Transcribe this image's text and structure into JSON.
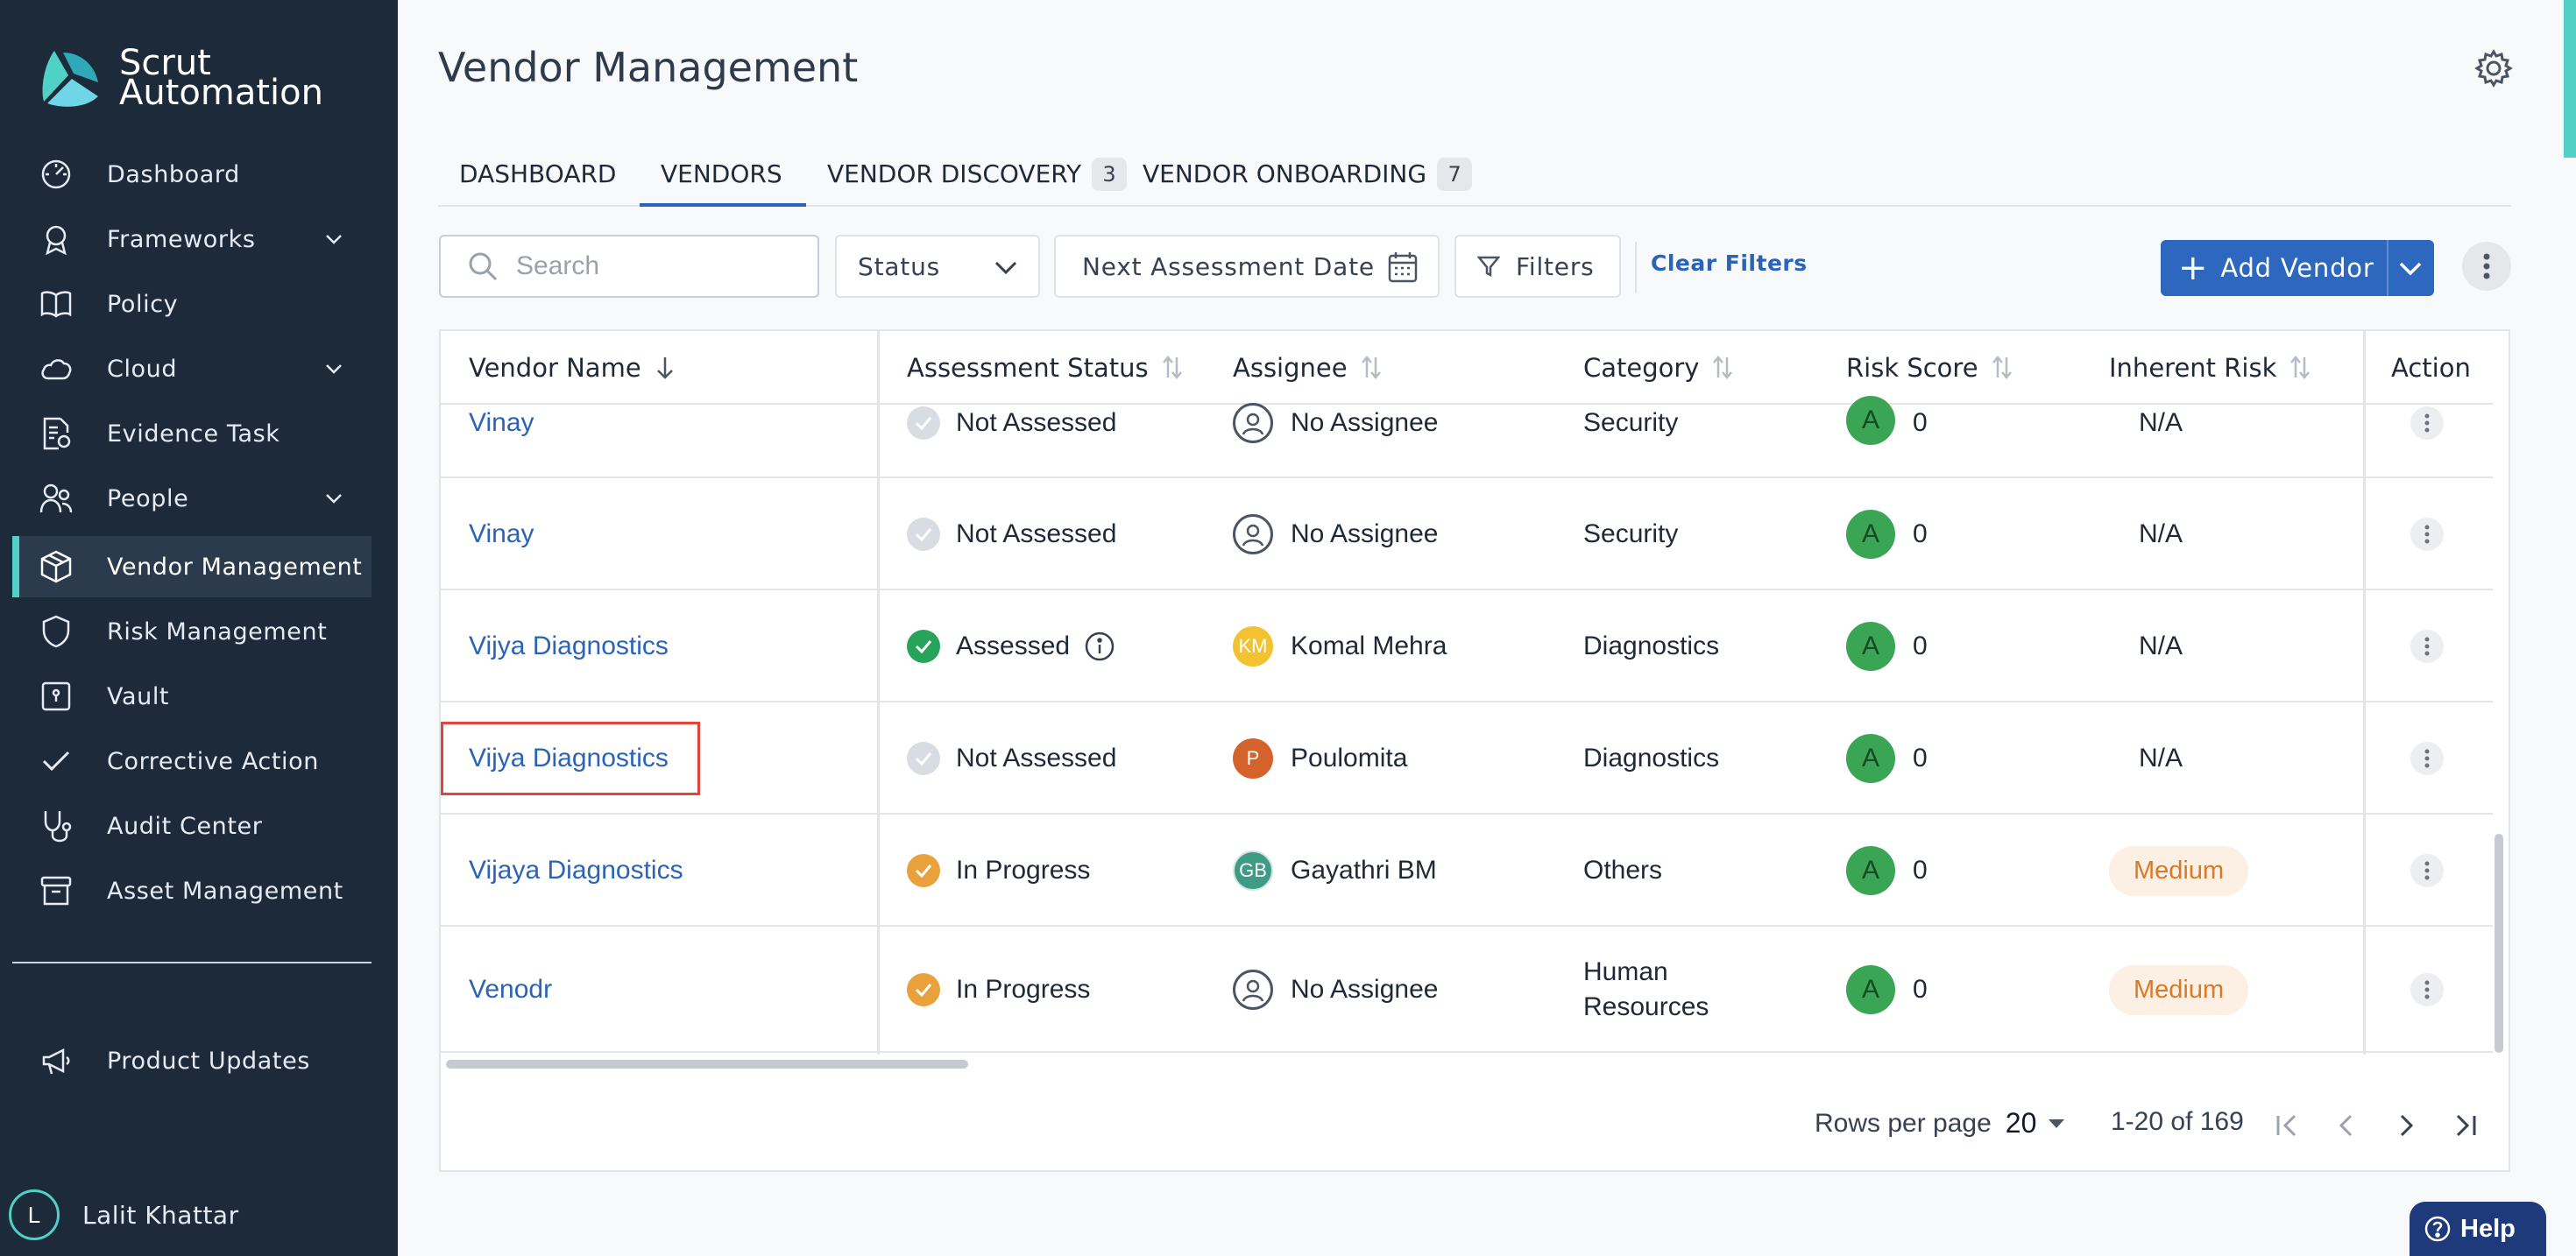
{
  "brand": {
    "line1": "Scrut",
    "line2": "Automation"
  },
  "sidebar": {
    "items": [
      {
        "label": "Dashboard",
        "icon": "dashboard-icon"
      },
      {
        "label": "Frameworks",
        "icon": "frameworks-icon",
        "expandable": true
      },
      {
        "label": "Policy",
        "icon": "policy-icon"
      },
      {
        "label": "Cloud",
        "icon": "cloud-icon",
        "expandable": true
      },
      {
        "label": "Evidence Task",
        "icon": "evidence-icon"
      },
      {
        "label": "People",
        "icon": "people-icon",
        "expandable": true
      },
      {
        "label": "Vendor Management",
        "icon": "vendor-icon",
        "active": true
      },
      {
        "label": "Risk Management",
        "icon": "shield-icon"
      },
      {
        "label": "Vault",
        "icon": "vault-icon"
      },
      {
        "label": "Corrective Action",
        "icon": "check-icon"
      },
      {
        "label": "Audit Center",
        "icon": "stethoscope-icon"
      },
      {
        "label": "Asset Management",
        "icon": "archive-icon"
      }
    ],
    "bottom_items": [
      {
        "label": "Product Updates",
        "icon": "megaphone-icon"
      }
    ],
    "user": {
      "initial": "L",
      "name": "Lalit Khattar"
    }
  },
  "page": {
    "title": "Vendor Management"
  },
  "tabs": [
    {
      "label": "DASHBOARD"
    },
    {
      "label": "VENDORS",
      "active": true
    },
    {
      "label": "VENDOR DISCOVERY",
      "badge": "3"
    },
    {
      "label": "VENDOR ONBOARDING",
      "badge": "7"
    }
  ],
  "toolbar": {
    "search_placeholder": "Search",
    "status_label": "Status",
    "date_label": "Next Assessment Date",
    "filters_label": "Filters",
    "clear_label": "Clear Filters",
    "add_label": "Add Vendor"
  },
  "table": {
    "columns": [
      "Vendor Name",
      "Assessment Status",
      "Assignee",
      "Category",
      "Risk Score",
      "Inherent Risk",
      "Action"
    ],
    "rows": [
      {
        "name": "Vinay",
        "status": "Not Assessed",
        "status_kind": "not",
        "assignee": "No Assignee",
        "assignee_kind": "none",
        "category": "Security",
        "risk_grade": "A",
        "risk_score": "0",
        "inherent": "N/A"
      },
      {
        "name": "Vinay",
        "status": "Not Assessed",
        "status_kind": "not",
        "assignee": "No Assignee",
        "assignee_kind": "none",
        "category": "Security",
        "risk_grade": "A",
        "risk_score": "0",
        "inherent": "N/A"
      },
      {
        "name": "Vijya Diagnostics",
        "status": "Assessed",
        "status_kind": "ok",
        "assignee": "Komal Mehra",
        "assignee_initials": "KM",
        "assignee_color": "#f2c230",
        "category": "Diagnostics",
        "risk_grade": "A",
        "risk_score": "0",
        "inherent": "N/A"
      },
      {
        "name": "Vijya Diagnostics",
        "status": "Not Assessed",
        "status_kind": "not",
        "assignee": "Poulomita",
        "assignee_initials": "P",
        "assignee_color": "#d4622a",
        "category": "Diagnostics",
        "risk_grade": "A",
        "risk_score": "0",
        "inherent": "N/A"
      },
      {
        "name": "Vijaya Diagnostics",
        "status": "In Progress",
        "status_kind": "prog",
        "assignee": "Gayathri BM",
        "assignee_initials": "GB",
        "assignee_color": "#3f9a86",
        "category": "Others",
        "risk_grade": "A",
        "risk_score": "0",
        "inherent": "Medium"
      },
      {
        "name": "Venodr",
        "status": "In Progress",
        "status_kind": "prog",
        "assignee": "No Assignee",
        "assignee_kind": "none",
        "category_line1": "Human",
        "category_line2": "Resources",
        "risk_grade": "A",
        "risk_score": "0",
        "inherent": "Medium"
      }
    ]
  },
  "pagination": {
    "rows_label": "Rows per page",
    "rows_value": "20",
    "range": "1-20 of 169"
  },
  "help": {
    "label": "Help"
  },
  "colors": {
    "accent": "#2e67be",
    "sidebar": "#1c2a3a",
    "highlight": "#e2453c"
  }
}
